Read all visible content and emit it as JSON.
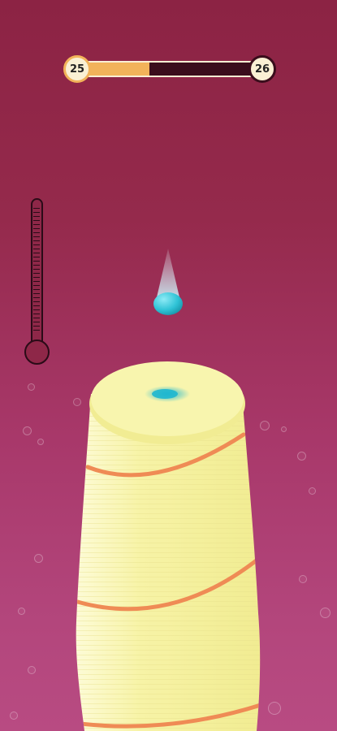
{
  "level": {
    "current": "25",
    "next": "26",
    "progress_fraction": 0.39
  },
  "colors": {
    "background_top": "#8c2344",
    "background_bottom": "#b84b82",
    "progress_fill": "#f2b35a",
    "tower": "#f6f29e",
    "stripe": "#ef8b55",
    "ball": "#2fc3d6"
  },
  "icons": {
    "ball": "falling-ball-icon",
    "thermometer": "thermometer-icon"
  }
}
